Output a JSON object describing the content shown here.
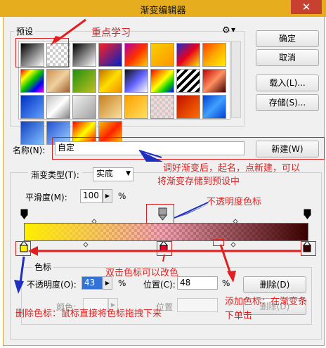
{
  "window": {
    "title": "渐变编辑器",
    "close_glyph": "✕"
  },
  "presets": {
    "label": "预设",
    "gear_glyph": "⚙",
    "swatches": [
      {
        "bg": "linear-gradient(135deg,#000 0%,#fff 100%)"
      },
      {
        "bg": "checker-gray"
      },
      {
        "bg": "linear-gradient(135deg,#000,#fff)"
      },
      {
        "bg": "linear-gradient(135deg,#ff2020,#0020c8)"
      },
      {
        "bg": "linear-gradient(135deg,#b000a0,#ff3000,#ffcc00)"
      },
      {
        "bg": "linear-gradient(135deg,#f7d000,#ff9400)"
      },
      {
        "bg": "linear-gradient(135deg,#1a2ecc,#e8001e,#f8e800)"
      },
      {
        "bg": "linear-gradient(135deg,#ff4000,#ffaa00,#fff000)"
      },
      {
        "bg": "linear-gradient(135deg,#ff0000,#ffff00,#00c000,#0000ff,#ff00ff)"
      },
      {
        "bg": "linear-gradient(135deg,#d09050,#f0d0a0,#a06030)"
      },
      {
        "bg": "linear-gradient(135deg,#209010,#c0c020)"
      },
      {
        "bg": "linear-gradient(135deg,#c07000,#ffdd00,#f09000)"
      },
      {
        "bg": "linear-gradient(135deg,#101010,#6060ff,#fff)"
      },
      {
        "bg": "linear-gradient(135deg,#ff0000,#ff8800,#ffff00,#00cc00,#0000ff)"
      },
      {
        "bg": "repeating-linear-gradient(135deg,#000 0 4px,#fff 4px 8px)"
      },
      {
        "bg": "linear-gradient(135deg,#c00000,#ff9060,#400000)"
      },
      {
        "bg": "linear-gradient(135deg,#0030c0,#60a0ff)"
      },
      {
        "bg": "linear-gradient(135deg,#c0c0c0,#fff,#808080)"
      },
      {
        "bg": "linear-gradient(135deg,#f0f0f0,#a0a0a0)"
      },
      {
        "bg": "linear-gradient(135deg,#c88020,#f8e0a0)"
      },
      {
        "bg": "linear-gradient(135deg,#ffa000,#ffe060)"
      },
      {
        "bg": "checker-red"
      },
      {
        "bg": "linear-gradient(135deg,#c01000,#ff7000)"
      },
      {
        "bg": "linear-gradient(135deg,#0040d0,#40a0ff,#0040d0)"
      },
      {
        "bg": "linear-gradient(135deg,#1040c0,#80c0ff)"
      },
      {
        "bg": "linear-gradient(135deg,#2050d0,#a0d0ff)"
      },
      {
        "bg": "linear-gradient(135deg,#ff0000,#ffff00,#ff0000)"
      },
      {
        "bg": "linear-gradient(135deg,#f0c000,#ff2000,#ffd000)"
      }
    ]
  },
  "buttons": {
    "ok": "确定",
    "cancel": "取消",
    "load": "载入(L)...",
    "save": "存储(S)...",
    "new": "新建(W)",
    "delete": "删除(D)",
    "delete_dim": "删除(D)"
  },
  "name_field": {
    "label": "名称(N):",
    "value": "自定"
  },
  "gradient": {
    "type_label": "渐变类型(T):",
    "type_value": "实底",
    "smooth_label": "平滑度(M):",
    "smooth_value": "100",
    "percent": "%",
    "colors": {
      "start": "#ffee00",
      "mid": "#e3002a",
      "end": "#3a0000"
    }
  },
  "stops": {
    "group_label": "色标",
    "opacity_label": "不透明度(O):",
    "opacity_value": "43",
    "location_label": "位置(C):",
    "location_value": "48",
    "percent": "%",
    "color_label_dim": "颜色:",
    "location_label_dim": "位置"
  },
  "annotations": {
    "key_learning": "重点学习",
    "save_tip_1": "调好渐变后，起名，点新建，可以",
    "save_tip_2": "将渐变存储到预设中",
    "opacity_stop": "不透明度色标",
    "double_click": "双击色标可以改色",
    "delete_tip": "删除色标：鼠标直接将色标拖拽下来",
    "add_tip_1": "添加色标：在渐变条",
    "add_tip_2": "下单击"
  }
}
